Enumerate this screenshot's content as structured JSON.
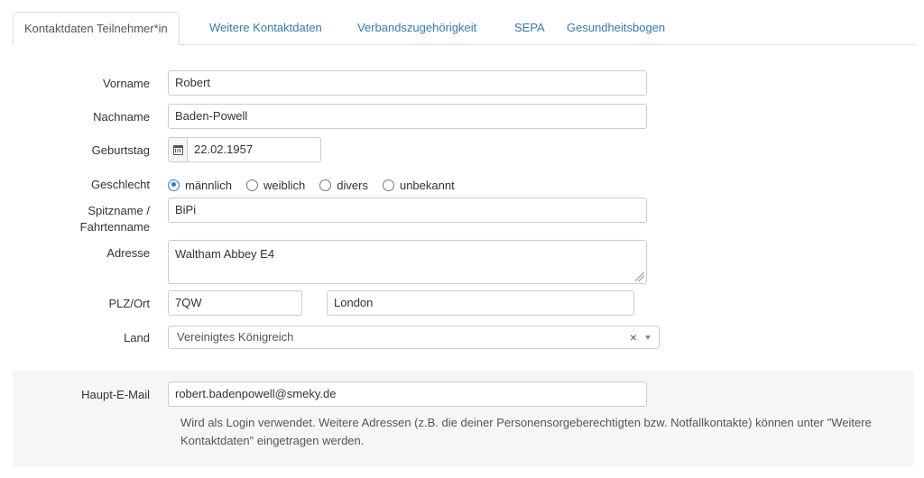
{
  "tabs": [
    {
      "label": "Kontaktdaten Teilnehmer*in",
      "active": true
    },
    {
      "label": "Weitere Kontaktdaten",
      "active": false
    },
    {
      "label": "Verbandszugehörigkeit",
      "active": false
    },
    {
      "label": "SEPA",
      "active": false
    },
    {
      "label": "Gesundheitsbogen",
      "active": false
    }
  ],
  "form": {
    "vorname": {
      "label": "Vorname",
      "value": "Robert"
    },
    "nachname": {
      "label": "Nachname",
      "value": "Baden-Powell"
    },
    "geburtstag": {
      "label": "Geburtstag",
      "value": "22.02.1957",
      "icon": "calendar-icon"
    },
    "geschlecht": {
      "label": "Geschlecht",
      "options": [
        "männlich",
        "weiblich",
        "divers",
        "unbekannt"
      ],
      "selected": "männlich"
    },
    "spitzname": {
      "label": "Spitzname / Fahrtenname",
      "value": "BiPi"
    },
    "adresse": {
      "label": "Adresse",
      "value": "Waltham Abbey E4"
    },
    "plz_ort": {
      "label": "PLZ/Ort",
      "plz": "7QW",
      "ort": "London"
    },
    "land": {
      "label": "Land",
      "value": "Vereinigtes Königreich",
      "clear_icon": "×"
    },
    "email": {
      "label": "Haupt-E-Mail",
      "value": "robert.badenpowell@smeky.de",
      "help": "Wird als Login verwendet. Weitere Adressen (z.B. die deiner Personensorgeberechtigten bzw. Notfallkontakte) können unter \"Weitere Kontaktdaten\" eingetragen werden."
    }
  },
  "colors": {
    "link": "#337ab7",
    "radio_accent": "#2e7bcf",
    "section_bg": "#f5f6f7"
  }
}
